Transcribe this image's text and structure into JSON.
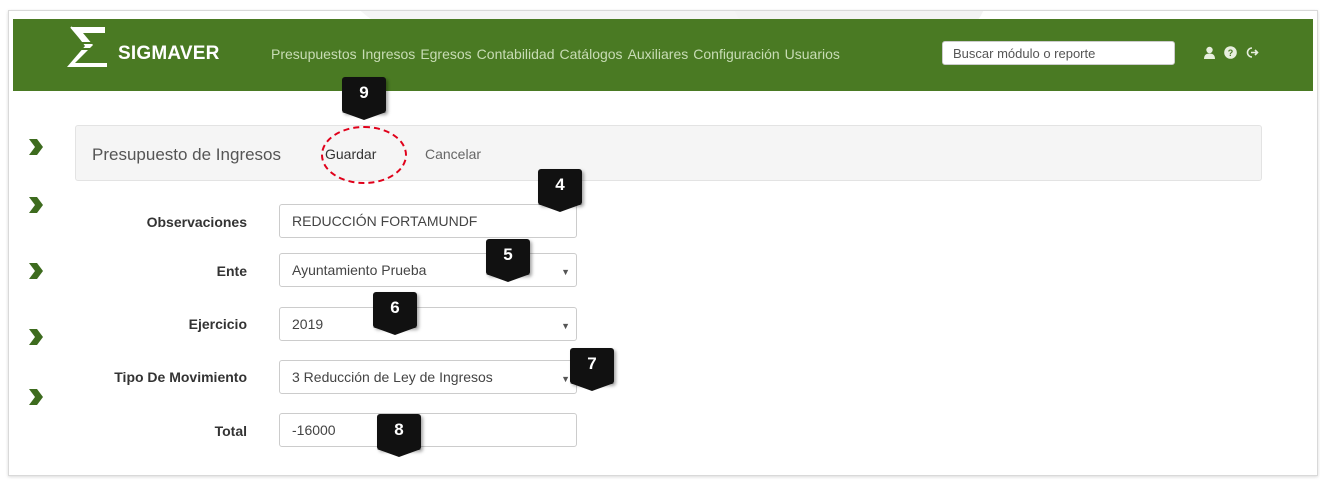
{
  "navbar": {
    "brand": "SIGMAVER",
    "menu": [
      "Presupuestos",
      "Ingresos",
      "Egresos",
      "Contabilidad",
      "Catálogos",
      "Auxiliares",
      "Configuración",
      "Usuarios"
    ],
    "search_placeholder": "Buscar módulo o reporte",
    "icons": [
      "user-icon",
      "help-icon",
      "logout-icon"
    ],
    "color": "#4a7a23"
  },
  "panel": {
    "title": "Presupuesto de Ingresos",
    "save_label": "Guardar",
    "cancel_label": "Cancelar"
  },
  "form": {
    "observaciones": {
      "label": "Observaciones",
      "value": "REDUCCIÓN FORTAMUNDF"
    },
    "ente": {
      "label": "Ente",
      "value": "Ayuntamiento Prueba"
    },
    "ejercicio": {
      "label": "Ejercicio",
      "value": "2019"
    },
    "tipo_movimiento": {
      "label": "Tipo De Movimiento",
      "value": "3 Reducción de Ley de Ingresos"
    },
    "total": {
      "label": "Total",
      "value": "-16000"
    }
  },
  "markers": {
    "m9": "9",
    "m4": "4",
    "m5": "5",
    "m6": "6",
    "m7": "7",
    "m8": "8"
  },
  "colors": {
    "accent": "#4a7a23",
    "highlight": "#e0001a"
  }
}
